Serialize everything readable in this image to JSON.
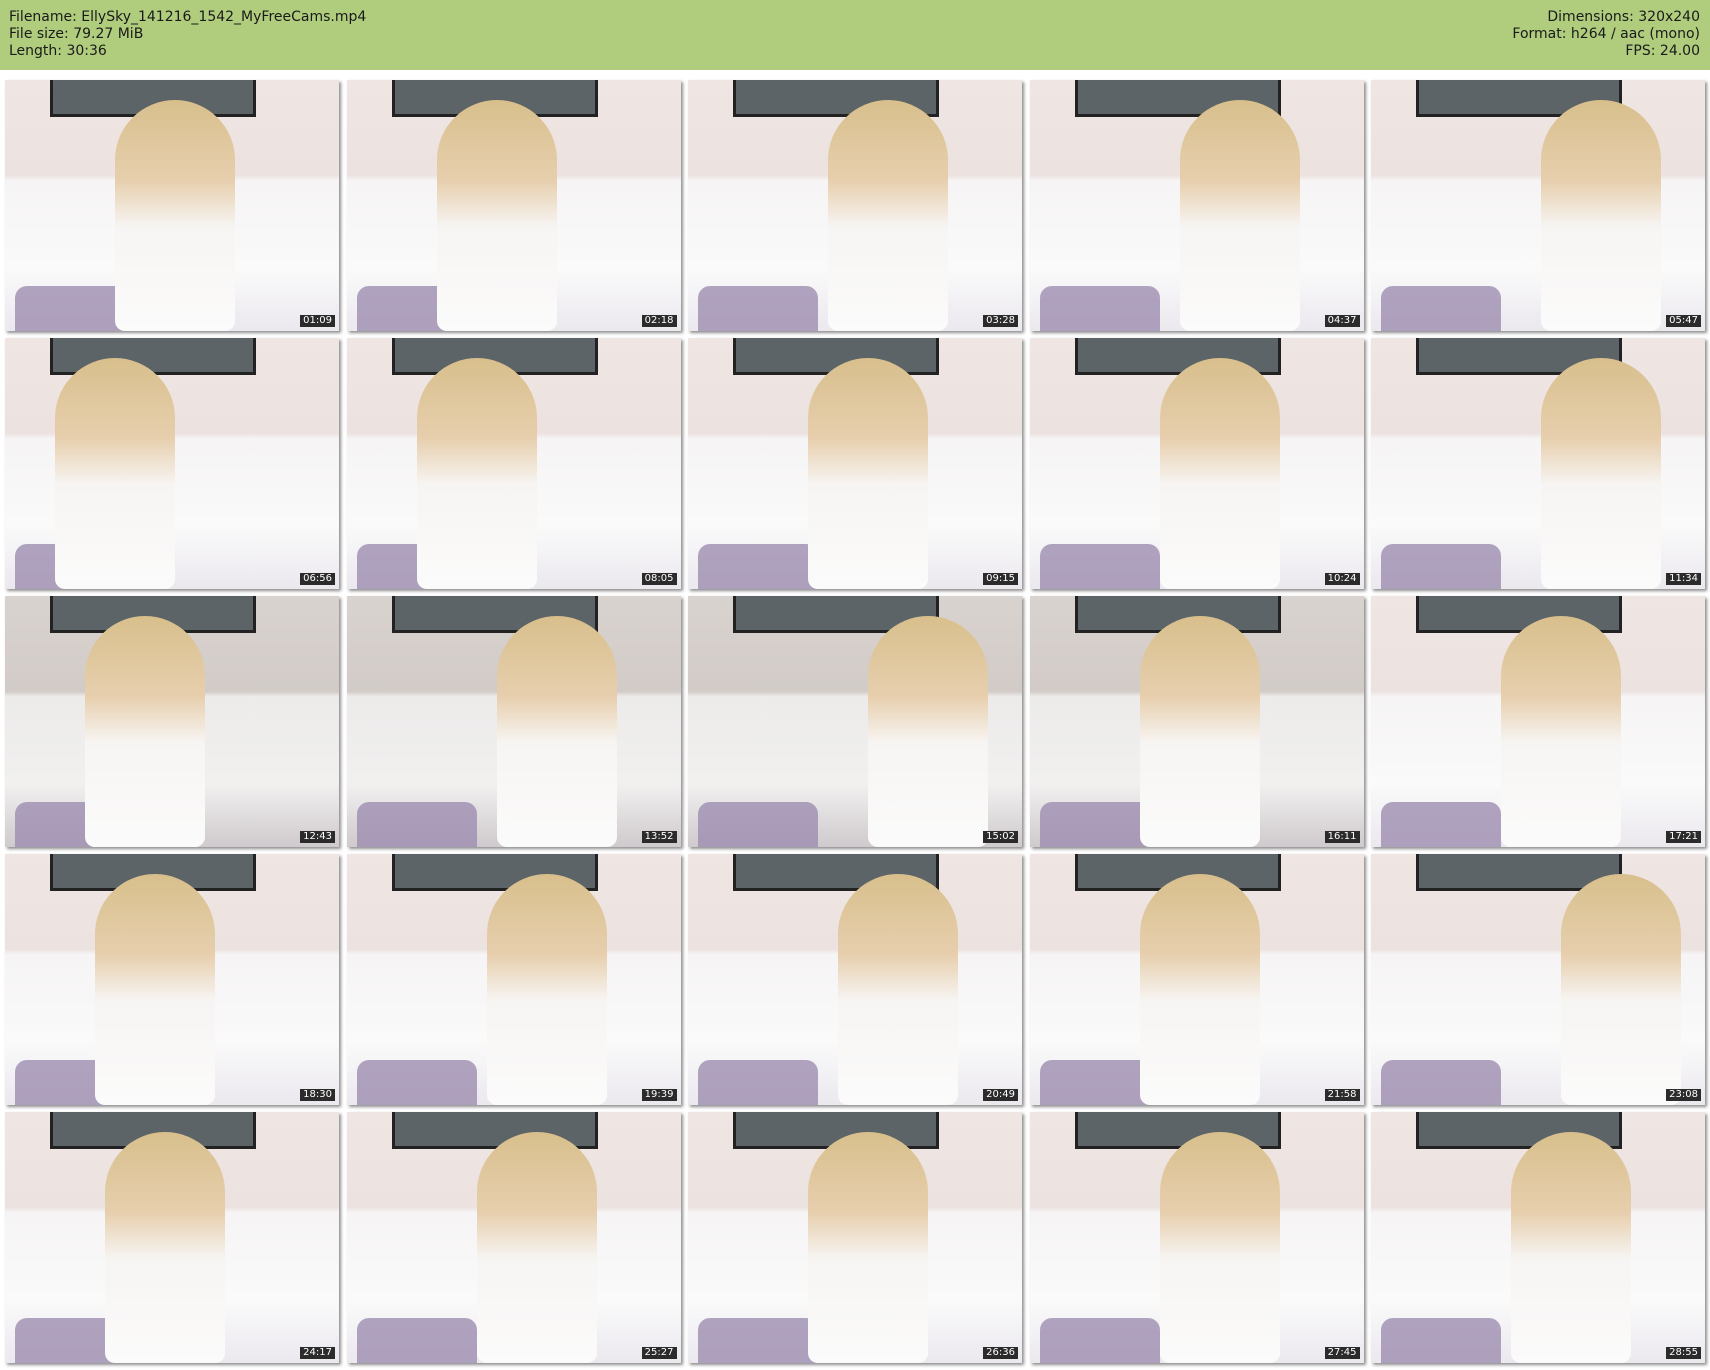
{
  "header": {
    "filename": "Filename: EllySky_141216_1542_MyFreeCams.mp4",
    "filesize": "File size: 79.27 MiB",
    "length": "Length: 30:36",
    "dimensions": "Dimensions: 320x240",
    "format": "Format: h264 / aac (mono)",
    "fps": "FPS: 24.00"
  },
  "thumbnails": [
    {
      "time": "01:09"
    },
    {
      "time": "02:18"
    },
    {
      "time": "03:28"
    },
    {
      "time": "04:37"
    },
    {
      "time": "05:47"
    },
    {
      "time": "06:56"
    },
    {
      "time": "08:05"
    },
    {
      "time": "09:15"
    },
    {
      "time": "10:24"
    },
    {
      "time": "11:34"
    },
    {
      "time": "12:43",
      "gray": true
    },
    {
      "time": "13:52",
      "gray": true
    },
    {
      "time": "15:02",
      "gray": true
    },
    {
      "time": "16:11",
      "gray": true
    },
    {
      "time": "17:21"
    },
    {
      "time": "18:30"
    },
    {
      "time": "19:39"
    },
    {
      "time": "20:49"
    },
    {
      "time": "21:58"
    },
    {
      "time": "23:08"
    },
    {
      "time": "24:17"
    },
    {
      "time": "25:27"
    },
    {
      "time": "26:36"
    },
    {
      "time": "27:45"
    },
    {
      "time": "28:55"
    }
  ],
  "colors": {
    "header_bg": "#b0cd7e"
  }
}
